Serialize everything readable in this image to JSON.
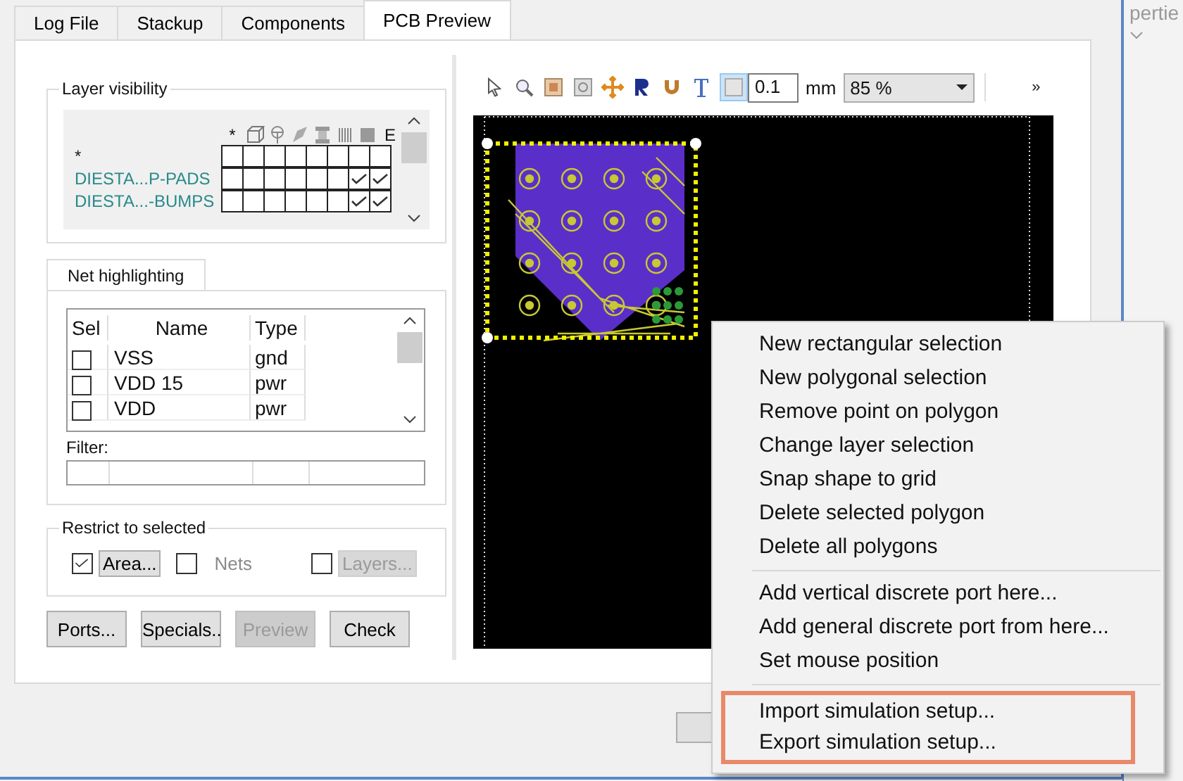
{
  "tabs": [
    {
      "label": "Log File",
      "selected": false
    },
    {
      "label": "Stackup",
      "selected": false
    },
    {
      "label": "Components",
      "selected": false
    },
    {
      "label": "PCB Preview",
      "selected": true
    }
  ],
  "layer_visibility": {
    "title": "Layer visibility",
    "first_header": "*",
    "last_header": "E",
    "rows": [
      {
        "name": "*",
        "color": "#202020",
        "checks": [
          false,
          false,
          false,
          false,
          false,
          false,
          false,
          false
        ]
      },
      {
        "name": "DIESTA...P-PADS",
        "color": "#2a8a8a",
        "checks": [
          false,
          false,
          false,
          false,
          false,
          false,
          true,
          true
        ]
      },
      {
        "name": "DIESTA...-BUMPS",
        "color": "#2a8a8a",
        "checks": [
          false,
          false,
          false,
          false,
          false,
          false,
          true,
          true
        ]
      }
    ]
  },
  "net_highlighting": {
    "tab_label": "Net highlighting",
    "columns": [
      "Sel",
      "Name",
      "Type"
    ],
    "rows": [
      {
        "checked": false,
        "name": "VSS",
        "type": "gnd"
      },
      {
        "checked": false,
        "name": "VDD 15",
        "type": "pwr"
      },
      {
        "checked": false,
        "name": "VDD",
        "type": "pwr"
      }
    ],
    "filter_label": "Filter:"
  },
  "restrict": {
    "title": "Restrict to selected",
    "options": [
      {
        "checked": true,
        "label": "Area...",
        "disabled": false,
        "kind": "button"
      },
      {
        "checked": false,
        "label": "Nets",
        "disabled": true,
        "kind": "label"
      },
      {
        "checked": false,
        "label": "Layers...",
        "disabled": true,
        "kind": "button"
      }
    ]
  },
  "buttons": [
    {
      "label": "Ports...",
      "disabled": false
    },
    {
      "label": "Specials..",
      "disabled": false
    },
    {
      "label": "Preview",
      "disabled": true
    },
    {
      "label": "Check",
      "disabled": false
    }
  ],
  "toolbar": {
    "grid_toggle_on": true,
    "grid_value": "0.1",
    "unit": "mm",
    "zoom": "85 %",
    "more": "»"
  },
  "context_menu": {
    "groups": [
      {
        "highlighted": false,
        "items": [
          "New rectangular selection",
          "New polygonal selection",
          "Remove point on polygon",
          "Change layer selection",
          "Snap shape to grid",
          "Delete selected polygon",
          "Delete all polygons"
        ]
      },
      {
        "highlighted": false,
        "items": [
          "Add vertical discrete port here...",
          "Add general discrete port from here...",
          "Set mouse position"
        ]
      },
      {
        "highlighted": true,
        "items": [
          "Import simulation setup...",
          "Export simulation setup..."
        ]
      }
    ]
  },
  "side_window": {
    "title_fragment": "pertie"
  }
}
